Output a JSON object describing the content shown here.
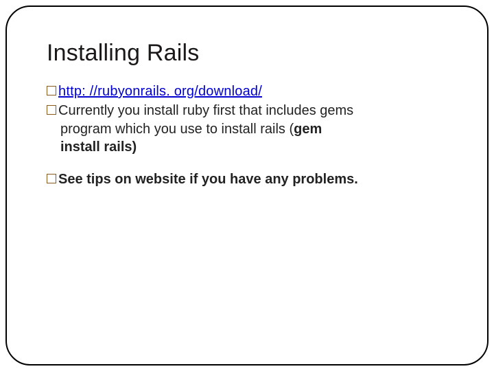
{
  "title": "Installing Rails",
  "bullets": {
    "b1": {
      "text": "http: //rubyonrails. org/download/"
    },
    "b2": {
      "line1": "Currently you install ruby first that includes gems",
      "line2a": "program which you use to install rails (",
      "line2b": "gem",
      "line3": "install rails)"
    },
    "b3": {
      "text": "See tips on website if you have any problems."
    }
  }
}
